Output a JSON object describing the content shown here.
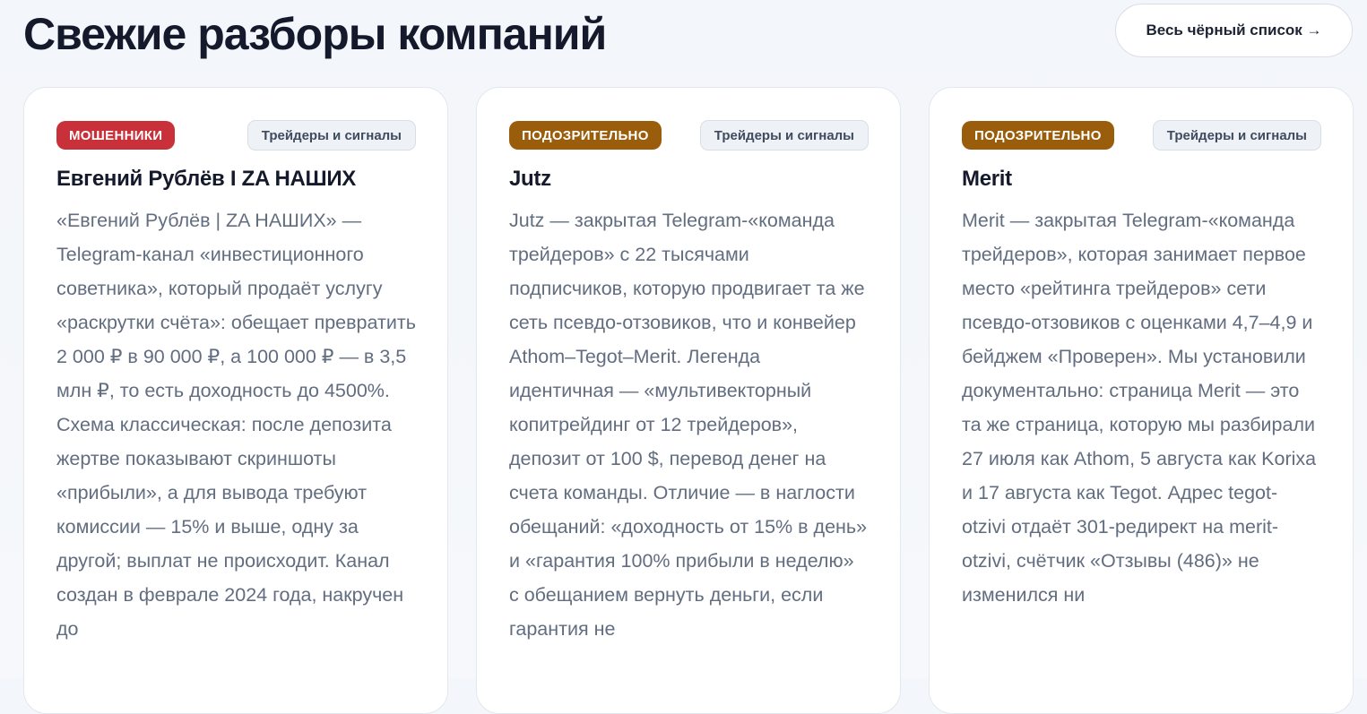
{
  "header": {
    "title": "Свежие разборы компаний",
    "blacklist_link": "Весь чёрный список →"
  },
  "colors": {
    "scam": "#c8303a",
    "suspicious": "#9a5d0b"
  },
  "cards": [
    {
      "status": "МОШЕННИКИ",
      "status_color": "#c8303a",
      "category": "Трейдеры и сигналы",
      "title": "Евгений Рублёв I ZA НАШИХ",
      "description": "«Евгений Рублёв | ZA НАШИХ» — Telegram-канал «инвестиционного советника», который продаёт услугу «раскрутки счёта»: обещает превратить 2 000 ₽ в 90 000 ₽, а 100 000 ₽ — в 3,5 млн ₽, то есть доходность до 4500%. Схема классическая: после депозита жертве показывают скриншоты «прибыли», а для вывода требуют комиссии — 15% и выше, одну за другой; выплат не происходит. Канал создан в феврале 2024 года, накручен до"
    },
    {
      "status": "ПОДОЗРИТЕЛЬНО",
      "status_color": "#9a5d0b",
      "category": "Трейдеры и сигналы",
      "title": "Jutz",
      "description": "Jutz — закрытая Telegram-«команда трейдеров» с 22 тысячами подписчиков, которую продвигает та же сеть псевдо-отзовиков, что и конвейер Athom–Tegot–Merit. Легенда идентичная — «мультивекторный копитрейдинг от 12 трейдеров», депозит от 100 $, перевод денег на счета команды. Отличие — в наглости обещаний: «доходность от 15% в день» и «гарантия 100% прибыли в неделю» с обещанием вернуть деньги, если гарантия не"
    },
    {
      "status": "ПОДОЗРИТЕЛЬНО",
      "status_color": "#9a5d0b",
      "category": "Трейдеры и сигналы",
      "title": "Merit",
      "description": "Merit — закрытая Telegram-«команда трейдеров», которая занимает первое место «рейтинга трейдеров» сети псевдо-отзовиков с оценками 4,7–4,9 и бейджем «Проверен». Мы установили документально: страница Merit — это та же страница, которую мы разбирали 27 июля как Athom, 5 августа как Korixa и 17 августа как Tegot. Адрес tegot-otzivi отдаёт 301-редирект на merit-otzivi, счётчик «Отзывы (486)» не изменился ни"
    }
  ]
}
